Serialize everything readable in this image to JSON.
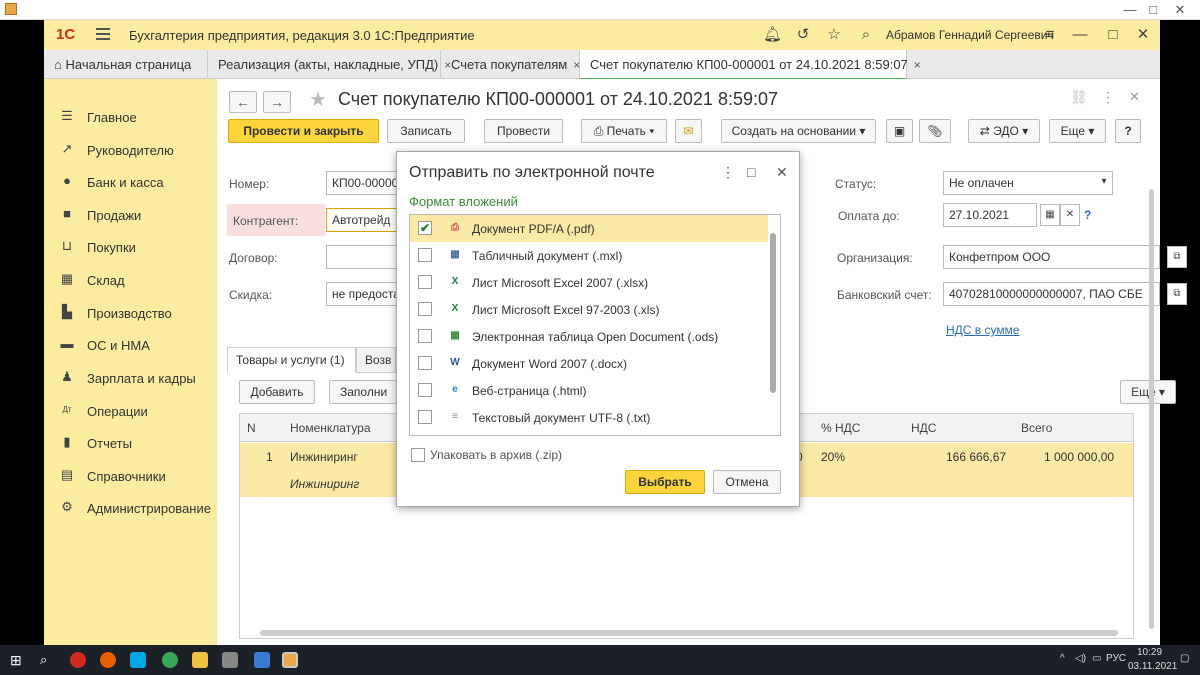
{
  "window": {
    "minimize": "—",
    "maximize": "□",
    "close": "✕"
  },
  "app": {
    "logo": "1С",
    "title": "Бухгалтерия предприятия, редакция 3.0 1С:Предприятие",
    "user": "Абрамов Геннадий Сергеевич"
  },
  "tabs": [
    {
      "label": "Начальная страница"
    },
    {
      "label": "Реализация (акты, накладные, УПД)",
      "close": "×"
    },
    {
      "label": "Счета покупателям",
      "close": "×"
    },
    {
      "label": "Счет покупателю КП00-000001 от 24.10.2021 8:59:07",
      "close": "×"
    }
  ],
  "sidebar": {
    "items": [
      {
        "label": "Главное",
        "icon": "menu-icon"
      },
      {
        "label": "Руководителю",
        "icon": "chart-icon"
      },
      {
        "label": "Банк и касса",
        "icon": "coin-icon"
      },
      {
        "label": "Продажи",
        "icon": "bag-icon"
      },
      {
        "label": "Покупки",
        "icon": "cart-icon"
      },
      {
        "label": "Склад",
        "icon": "grid-icon"
      },
      {
        "label": "Производство",
        "icon": "factory-icon"
      },
      {
        "label": "ОС и НМА",
        "icon": "truck-icon"
      },
      {
        "label": "Зарплата и кадры",
        "icon": "person-icon"
      },
      {
        "label": "Операции",
        "icon": "dt-kt-icon"
      },
      {
        "label": "Отчеты",
        "icon": "bar-chart-icon"
      },
      {
        "label": "Справочники",
        "icon": "book-icon"
      },
      {
        "label": "Администрирование",
        "icon": "gear-icon"
      }
    ]
  },
  "doc": {
    "title": "Счет покупателю КП00-000001 от 24.10.2021 8:59:07",
    "toolbar": {
      "post_close": "Провести и закрыть",
      "save": "Записать",
      "post": "Провести",
      "print": "Печать",
      "create_based": "Создать на основании",
      "edo": "ЭДО",
      "more": "Еще",
      "help": "?"
    },
    "fields": {
      "number_label": "Номер:",
      "number_value": "КП00-00000",
      "contractor_label": "Контрагент:",
      "contractor_value": "Автотрейд",
      "contract_label": "Договор:",
      "contract_value": "",
      "discount_label": "Скидка:",
      "discount_value": "не предоста",
      "status_label": "Статус:",
      "status_value": "Не оплачен",
      "pay_until_label": "Оплата до:",
      "pay_until_value": "27.10.2021",
      "org_label": "Организация:",
      "org_value": "Конфетпром ООО",
      "bank_label": "Банковский счет:",
      "bank_value": "40702810000000000007, ПАО СБЕ",
      "vat_link": "НДС в сумме",
      "help_mark": "?"
    },
    "inner_tabs": [
      {
        "label": "Товары и услуги (1)"
      },
      {
        "label": "Возв"
      }
    ],
    "grid_toolbar": {
      "add": "Добавить",
      "fill": "Заполни",
      "more": "Еще"
    },
    "grid": {
      "headers": {
        "n": "N",
        "item": "Номенклатура",
        "vat_pct": "% НДС",
        "vat": "НДС",
        "total": "Всего"
      },
      "rows": [
        {
          "n": "1",
          "item": "Инжиниринг",
          "item_sub": "Инжиниринг",
          "qty_tail": "0",
          "vat_pct": "20%",
          "vat": "166 666,67",
          "total": "1 000 000,00"
        }
      ]
    }
  },
  "dialog": {
    "title": "Отправить по электронной почте",
    "subtitle": "Формат вложений",
    "formats": [
      {
        "label": "Документ PDF/A (.pdf)",
        "checked": true,
        "icon": "pdf-icon",
        "glyph": "⎙",
        "color": "#d9534f"
      },
      {
        "label": "Табличный документ (.mxl)",
        "checked": false,
        "icon": "mxl-icon",
        "glyph": "▦",
        "color": "#4a6fa5"
      },
      {
        "label": "Лист Microsoft Excel 2007 (.xlsx)",
        "checked": false,
        "icon": "excel-icon",
        "glyph": "X",
        "color": "#1e7a3c"
      },
      {
        "label": "Лист Microsoft Excel 97-2003 (.xls)",
        "checked": false,
        "icon": "excel-icon",
        "glyph": "X",
        "color": "#1e7a3c"
      },
      {
        "label": "Электронная таблица Open Document (.ods)",
        "checked": false,
        "icon": "ods-icon",
        "glyph": "▦",
        "color": "#3d8b3d"
      },
      {
        "label": "Документ Word 2007 (.docx)",
        "checked": false,
        "icon": "word-icon",
        "glyph": "W",
        "color": "#2b5797"
      },
      {
        "label": "Веб-страница (.html)",
        "checked": false,
        "icon": "web-icon",
        "glyph": "e",
        "color": "#1e88e5"
      },
      {
        "label": "Текстовый документ UTF-8 (.txt)",
        "checked": false,
        "icon": "txt-icon",
        "glyph": "≡",
        "color": "#888888"
      }
    ],
    "zip_label": "Упаковать в архив (.zip)",
    "select": "Выбрать",
    "cancel": "Отмена"
  },
  "taskbar": {
    "lang": "РУС",
    "time": "10:29",
    "date": "03.11.2021"
  },
  "colors": {
    "accent_yellow": "#fbd53b",
    "sidebar": "#fbec9f",
    "selection": "#fbe9a6",
    "link": "#2a6ebb"
  }
}
